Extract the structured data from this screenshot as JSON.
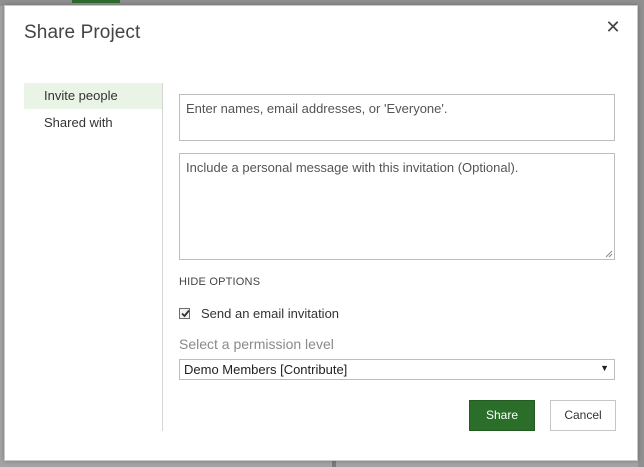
{
  "dialog": {
    "title": "Share Project",
    "close_label": "✕"
  },
  "sidebar": {
    "items": [
      {
        "label": "Invite people",
        "active": true
      },
      {
        "label": "Shared with",
        "active": false
      }
    ]
  },
  "form": {
    "names_placeholder": "Enter names, email addresses, or 'Everyone'.",
    "message_placeholder": "Include a personal message with this invitation (Optional).",
    "hide_options_label": "HIDE OPTIONS",
    "send_email_label": "Send an email invitation",
    "send_email_checked": true,
    "permission_label": "Select a permission level",
    "permission_value": "Demo Members [Contribute]",
    "select_arrow": "▼"
  },
  "buttons": {
    "share_label": "Share",
    "cancel_label": "Cancel"
  },
  "colors": {
    "accent": "#2a6e2a",
    "active_tab_bg": "#e9f3e6"
  }
}
